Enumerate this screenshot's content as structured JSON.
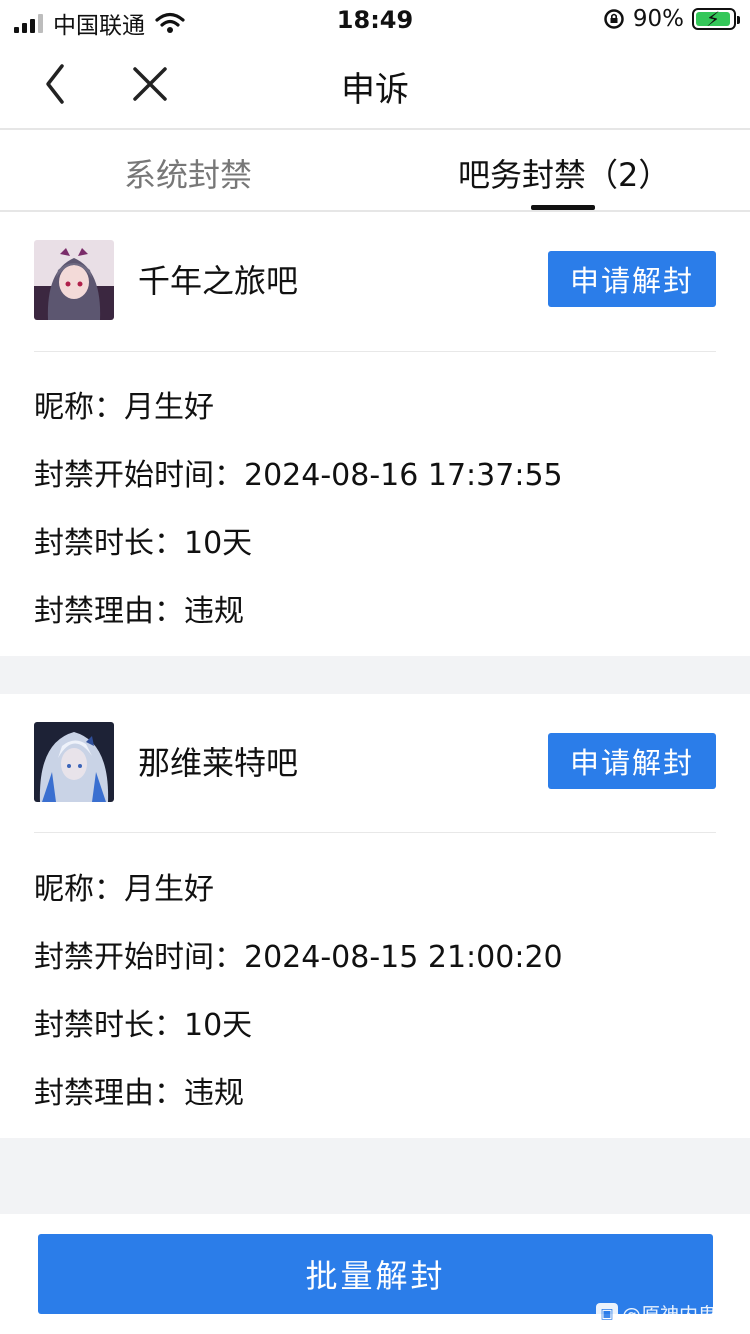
{
  "status_bar": {
    "carrier": "中国联通",
    "time": "18:49",
    "battery": "90%",
    "battery_level": 0.9
  },
  "nav": {
    "title": "申诉"
  },
  "tabs": [
    {
      "label": "系统封禁",
      "active": false
    },
    {
      "label": "吧务封禁（2）",
      "active": true
    }
  ],
  "cards": [
    {
      "bar_name": "千年之旅吧",
      "appeal_label": "申请解封",
      "nickname_label": "昵称：",
      "nickname": "月生好",
      "start_label": "封禁开始时间：",
      "start_time": "2024-08-16 17:37:55",
      "duration_label": "封禁时长：",
      "duration": "10天",
      "reason_label": "封禁理由：",
      "reason": "违规"
    },
    {
      "bar_name": "那维莱特吧",
      "appeal_label": "申请解封",
      "nickname_label": "昵称：",
      "nickname": "月生好",
      "start_label": "封禁开始时间：",
      "start_time": "2024-08-15 21:00:20",
      "duration_label": "封禁时长：",
      "duration": "10天",
      "reason_label": "封禁理由：",
      "reason": "违规"
    }
  ],
  "bottom_button": "批量解封",
  "watermark": "@原神内鬼",
  "colors": {
    "accent": "#2b7de9",
    "separator": "#f2f3f5",
    "battery": "#34c759"
  }
}
